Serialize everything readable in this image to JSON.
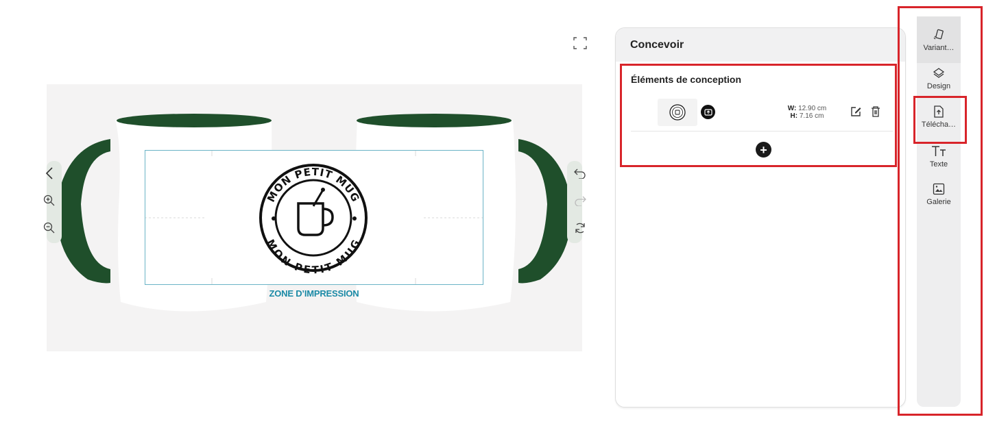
{
  "canvas": {
    "print_zone_label": "ZONE D’IMPRESSION",
    "logo_text_top": "MON PETIT MUG",
    "logo_text_bottom": "MON PETIT MUG",
    "colors": {
      "mug_rim": "#1f4f2b",
      "print_zone_border": "#6ab3c6",
      "zone_label": "#1b8aa6"
    }
  },
  "designer": {
    "title": "Concevoir",
    "section_title": "Éléments de conception",
    "element": {
      "width_label": "W:",
      "width_value": "12.90 cm",
      "height_label": "H:",
      "height_value": "7.16 cm"
    },
    "add_label": "+"
  },
  "sidebar": {
    "items": [
      {
        "label": "Variant…",
        "icon": "variant-icon"
      },
      {
        "label": "Design",
        "icon": "layers-icon"
      },
      {
        "label": "Télécha…",
        "icon": "upload-icon"
      },
      {
        "label": "Texte",
        "icon": "text-icon"
      },
      {
        "label": "Galerie",
        "icon": "gallery-icon"
      }
    ]
  },
  "accent_colors": {
    "highlight": "#d8242a"
  }
}
